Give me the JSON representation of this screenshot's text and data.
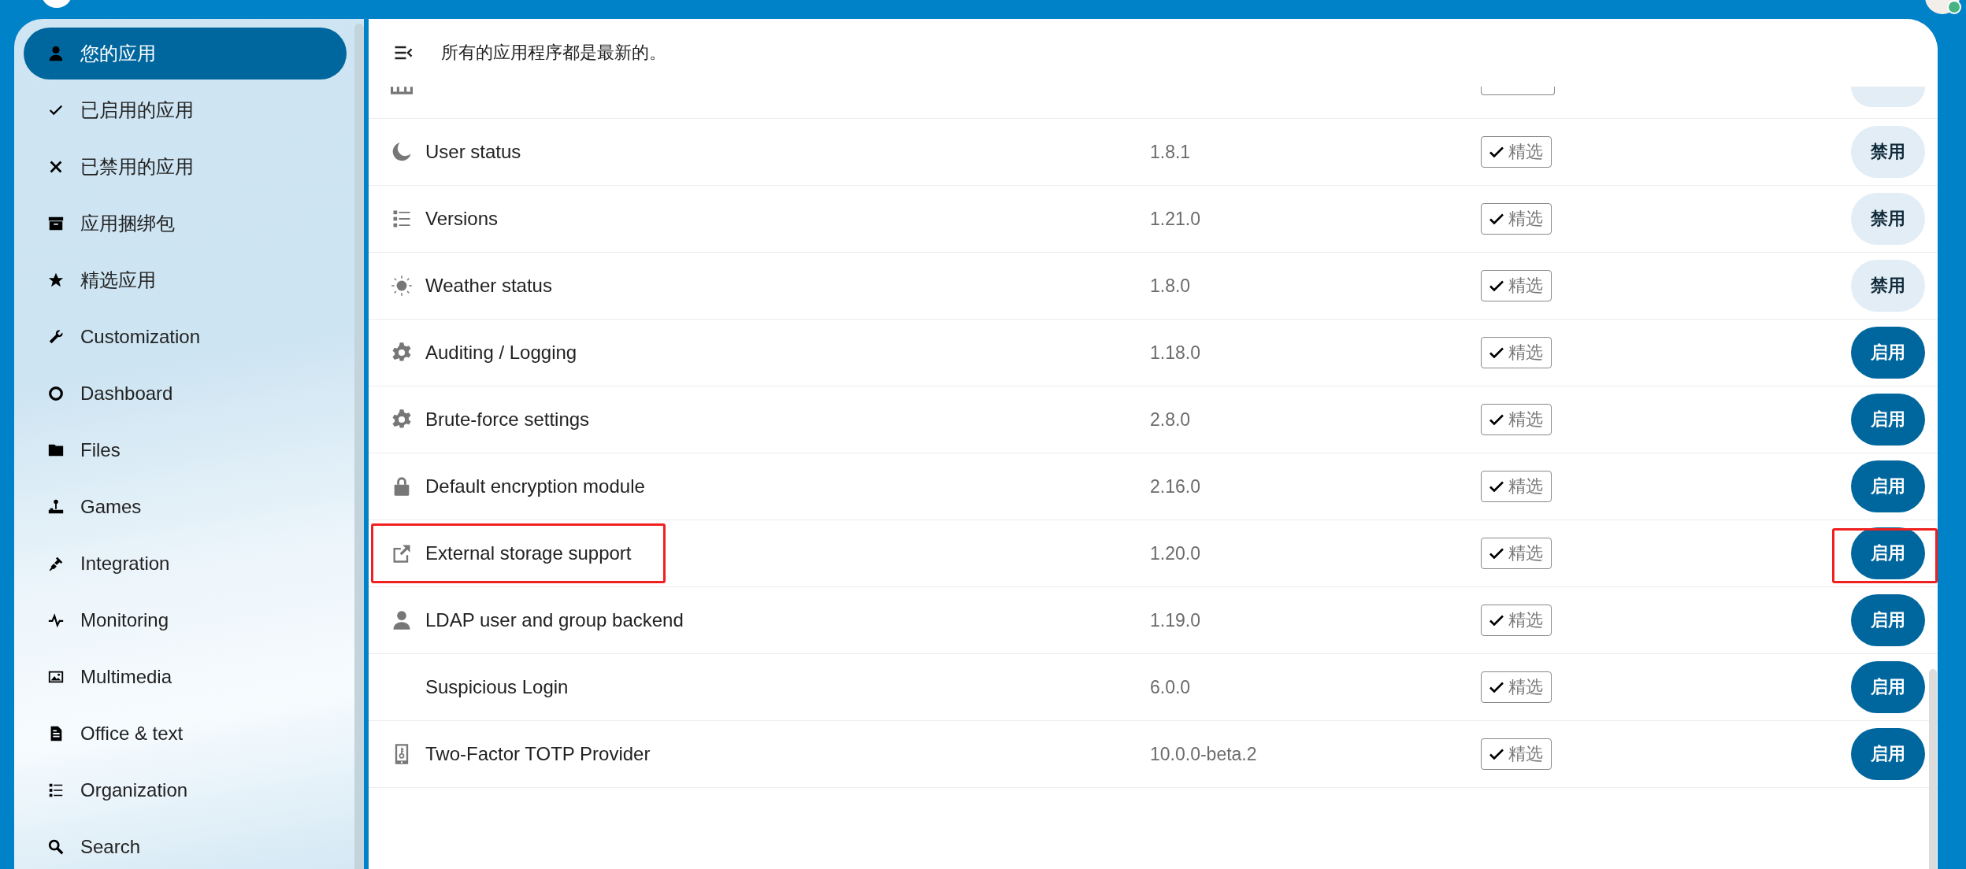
{
  "sidebar": {
    "items": [
      {
        "label": "您的应用",
        "selected": true
      },
      {
        "label": "已启用的应用",
        "selected": false
      },
      {
        "label": "已禁用的应用",
        "selected": false
      },
      {
        "label": "应用捆绑包",
        "selected": false
      },
      {
        "label": "精选应用",
        "selected": false
      },
      {
        "label": "Customization",
        "selected": false
      },
      {
        "label": "Dashboard",
        "selected": false
      },
      {
        "label": "Files",
        "selected": false
      },
      {
        "label": "Games",
        "selected": false
      },
      {
        "label": "Integration",
        "selected": false
      },
      {
        "label": "Monitoring",
        "selected": false
      },
      {
        "label": "Multimedia",
        "selected": false
      },
      {
        "label": "Office & text",
        "selected": false
      },
      {
        "label": "Organization",
        "selected": false
      },
      {
        "label": "Search",
        "selected": false
      }
    ]
  },
  "header": {
    "message": "所有的应用程序都是最新的。"
  },
  "apps": [
    {
      "partial": true,
      "featured": true,
      "enabled": true,
      "highlighted": false
    },
    {
      "name": "User status",
      "version": "1.8.1",
      "featured": true,
      "featured_label": "精选",
      "enabled": true,
      "button": "禁用",
      "highlighted": false
    },
    {
      "name": "Versions",
      "version": "1.21.0",
      "featured": true,
      "featured_label": "精选",
      "enabled": true,
      "button": "禁用",
      "highlighted": false
    },
    {
      "name": "Weather status",
      "version": "1.8.0",
      "featured": true,
      "featured_label": "精选",
      "enabled": true,
      "button": "禁用",
      "highlighted": false
    },
    {
      "name": "Auditing / Logging",
      "version": "1.18.0",
      "featured": true,
      "featured_label": "精选",
      "enabled": false,
      "button": "启用",
      "highlighted": false
    },
    {
      "name": "Brute-force settings",
      "version": "2.8.0",
      "featured": true,
      "featured_label": "精选",
      "enabled": false,
      "button": "启用",
      "highlighted": false
    },
    {
      "name": "Default encryption module",
      "version": "2.16.0",
      "featured": true,
      "featured_label": "精选",
      "enabled": false,
      "button": "启用",
      "highlighted": false
    },
    {
      "name": "External storage support",
      "version": "1.20.0",
      "featured": true,
      "featured_label": "精选",
      "enabled": false,
      "button": "启用",
      "highlighted": true
    },
    {
      "name": "LDAP user and group backend",
      "version": "1.19.0",
      "featured": true,
      "featured_label": "精选",
      "enabled": false,
      "button": "启用",
      "highlighted": false
    },
    {
      "name": "Suspicious Login",
      "version": "6.0.0",
      "featured": true,
      "featured_label": "精选",
      "enabled": false,
      "button": "启用",
      "highlighted": false
    },
    {
      "name": "Two-Factor TOTP Provider",
      "version": "10.0.0-beta.2",
      "featured": true,
      "featured_label": "精选",
      "enabled": false,
      "button": "启用",
      "highlighted": false
    }
  ]
}
